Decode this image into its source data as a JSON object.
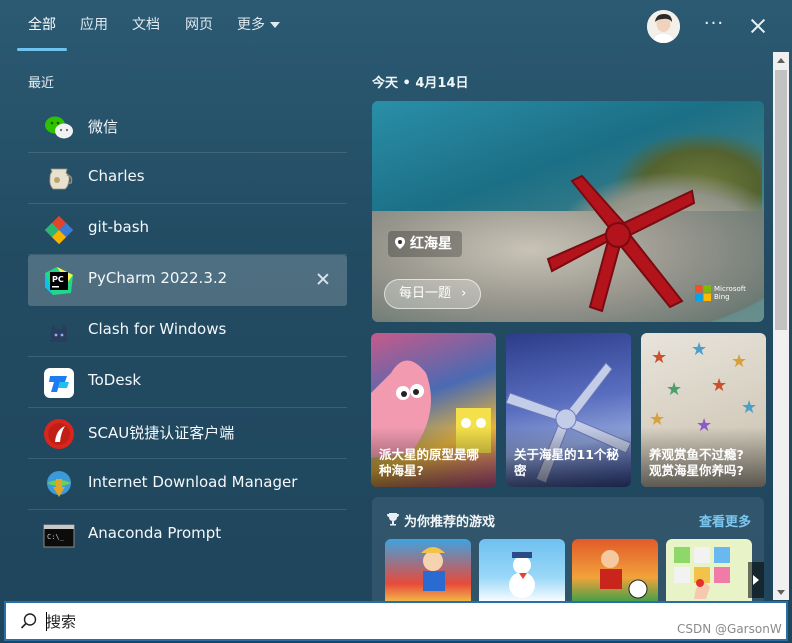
{
  "tabs": [
    {
      "label": "全部",
      "active": true
    },
    {
      "label": "应用",
      "active": false
    },
    {
      "label": "文档",
      "active": false
    },
    {
      "label": "网页",
      "active": false
    },
    {
      "label": "更多",
      "active": false
    }
  ],
  "header": {
    "more_label": "···"
  },
  "recent": {
    "title": "最近",
    "items": [
      {
        "label": "微信",
        "icon": "wechat-icon"
      },
      {
        "label": "Charles",
        "icon": "charles-icon"
      },
      {
        "label": "git-bash",
        "icon": "git-icon"
      },
      {
        "label": "PyCharm 2022.3.2",
        "icon": "pycharm-icon",
        "selected": true
      },
      {
        "label": "Clash for Windows",
        "icon": "clash-icon"
      },
      {
        "label": "ToDesk",
        "icon": "todesk-icon"
      },
      {
        "label": "SCAU锐捷认证客户端",
        "icon": "ruijie-icon"
      },
      {
        "label": "Internet Download Manager",
        "icon": "idm-icon"
      },
      {
        "label": "Anaconda Prompt",
        "icon": "terminal-icon"
      }
    ]
  },
  "today": {
    "date": "今天 • 4月14日",
    "hero": {
      "location": "红海星",
      "daily_label": "每日一题",
      "brand": "Microsoft Bing"
    },
    "stories": [
      {
        "title": "派大星的原型是哪种海星?"
      },
      {
        "title": "关于海星的11个秘密"
      },
      {
        "title": "养观赏鱼不过瘾? 观赏海星你养吗?"
      }
    ]
  },
  "games": {
    "title": "为你推荐的游戏",
    "more": "查看更多"
  },
  "search": {
    "placeholder": "搜索",
    "value": ""
  },
  "watermark": "CSDN @GarsonW",
  "colors": {
    "accent": "#6fc3f0",
    "panel": "#244d64",
    "link": "#7cc7f2"
  }
}
